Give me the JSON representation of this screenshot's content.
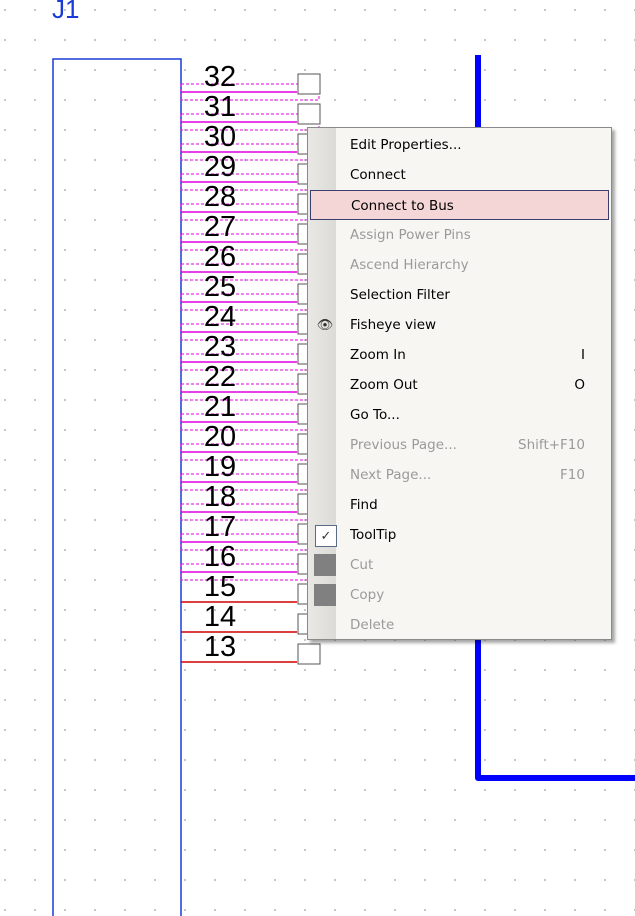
{
  "schematic": {
    "ref": "J1",
    "pins": [
      {
        "num": "32",
        "state": "selected"
      },
      {
        "num": "31",
        "state": "selected"
      },
      {
        "num": "30",
        "state": "selected"
      },
      {
        "num": "29",
        "state": "selected"
      },
      {
        "num": "28",
        "state": "selected"
      },
      {
        "num": "27",
        "state": "selected"
      },
      {
        "num": "26",
        "state": "selected"
      },
      {
        "num": "25",
        "state": "selected"
      },
      {
        "num": "24",
        "state": "selected"
      },
      {
        "num": "23",
        "state": "selected"
      },
      {
        "num": "22",
        "state": "selected"
      },
      {
        "num": "21",
        "state": "selected"
      },
      {
        "num": "20",
        "state": "selected"
      },
      {
        "num": "19",
        "state": "selected"
      },
      {
        "num": "18",
        "state": "selected"
      },
      {
        "num": "17",
        "state": "selected"
      },
      {
        "num": "16",
        "state": "selected"
      },
      {
        "num": "15",
        "state": "normal"
      },
      {
        "num": "14",
        "state": "normal"
      },
      {
        "num": "13",
        "state": "normal"
      }
    ],
    "colors": {
      "part_outline": "#1a3bd6",
      "selected_pin": "#e000e0",
      "normal_pin": "#d00000",
      "bus": "#0000ff"
    }
  },
  "menu": {
    "items": [
      {
        "label": "Edit Properties...",
        "shortcut": "",
        "disabled": false,
        "icon": ""
      },
      {
        "label": "Connect",
        "shortcut": "",
        "disabled": false,
        "icon": ""
      },
      {
        "label": "Connect to Bus",
        "shortcut": "",
        "disabled": false,
        "icon": "",
        "highlight": true
      },
      {
        "label": "Assign Power Pins",
        "shortcut": "",
        "disabled": true,
        "icon": ""
      },
      {
        "label": "Ascend Hierarchy",
        "shortcut": "",
        "disabled": true,
        "icon": ""
      },
      {
        "label": "Selection Filter",
        "shortcut": "",
        "disabled": false,
        "icon": ""
      },
      {
        "label": "Fisheye view",
        "shortcut": "",
        "disabled": false,
        "icon": "eye-icon",
        "glyph": "👁"
      },
      {
        "label": "Zoom In",
        "shortcut": "I",
        "disabled": false,
        "icon": ""
      },
      {
        "label": "Zoom Out",
        "shortcut": "O",
        "disabled": false,
        "icon": ""
      },
      {
        "label": "Go To...",
        "shortcut": "",
        "disabled": false,
        "icon": ""
      },
      {
        "label": "Previous Page...",
        "shortcut": "Shift+F10",
        "disabled": true,
        "icon": ""
      },
      {
        "label": "Next Page...",
        "shortcut": "F10",
        "disabled": true,
        "icon": ""
      },
      {
        "label": "Find",
        "shortcut": "",
        "disabled": false,
        "icon": ""
      },
      {
        "label": "ToolTip",
        "shortcut": "",
        "disabled": false,
        "icon": "check-icon",
        "glyph": "✓"
      },
      {
        "label": "Cut",
        "shortcut": "",
        "disabled": true,
        "icon": "cut-icon"
      },
      {
        "label": "Copy",
        "shortcut": "",
        "disabled": true,
        "icon": "copy-icon"
      },
      {
        "label": "Delete",
        "shortcut": "",
        "disabled": true,
        "icon": ""
      }
    ]
  }
}
